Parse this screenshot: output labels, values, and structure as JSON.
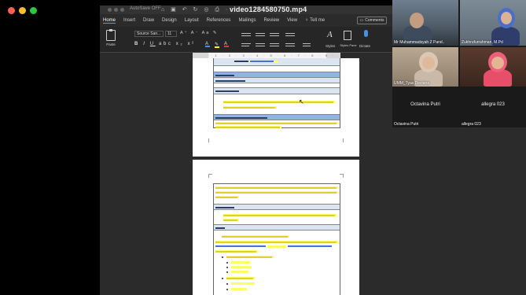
{
  "window": {
    "title": "video1284580750.mp4",
    "autosave": "AutoSave",
    "autosave_state": "OFF"
  },
  "ribbon": {
    "tabs": [
      "Home",
      "Insert",
      "Draw",
      "Design",
      "Layout",
      "References",
      "Mailings",
      "Review",
      "View"
    ],
    "tell_me": "Tell me",
    "comments": "Comments",
    "paste": "Paste",
    "font_name": "Source San...",
    "font_size": "11",
    "styles": "Styles",
    "styles_pane": "Styles Pane",
    "dictate": "Dictate"
  },
  "participants": [
    {
      "name": "Mr Muhammadsyah Z Pand.."
    },
    {
      "name": "Zukhrufurrahman, M.Pd"
    },
    {
      "name": "UMM_Tyas Deviana"
    },
    {
      "name": "Octavina Putri",
      "caption": "Octavina Putri"
    },
    {
      "name": "allegra 023",
      "caption": "allegra 023"
    }
  ],
  "colors": {
    "table_header": "#8db4e2",
    "table_light": "#dbe5f1",
    "highlight": "#ffff66",
    "accent": "#4a90e2"
  }
}
